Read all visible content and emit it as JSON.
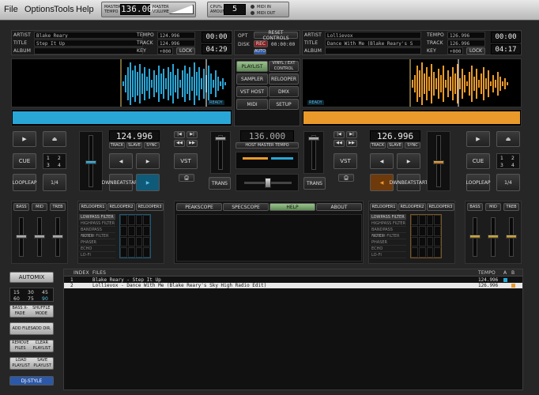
{
  "menubar": {
    "items": [
      "File",
      "Options",
      "Tools",
      "Help"
    ],
    "master_tempo_label": "MASTER TEMPO",
    "master_tempo": "136.000",
    "master_volume_label": "MASTER VOLUME",
    "cpu_label": "CPU% AMOUNT",
    "cpu_value": "5",
    "midi_in": "MIDI IN",
    "midi_out": "MIDI OUT"
  },
  "deck_left": {
    "artist_label": "ARTIST",
    "artist": "Blake Reary",
    "title_label": "TITLE",
    "title": "Step It Up",
    "album_label": "ALBUM",
    "album": "",
    "tempo_label": "TEMPO",
    "tempo": "124.996",
    "track_label": "TRACK",
    "track": "124.996",
    "key_label": "KEY",
    "key": "+000",
    "lock": "LOCK",
    "time1": "00:00",
    "time2": "04:29",
    "bpm_big": "124.996",
    "ready": "READY"
  },
  "deck_right": {
    "artist_label": "ARTIST",
    "artist": "Lollievox",
    "title_label": "TITLE",
    "title": "Dance With Me (Blake Reary's S",
    "album_label": "ALBUM",
    "album": "",
    "tempo_label": "TEMPO",
    "tempo": "126.996",
    "track_label": "TRACK",
    "track": "126.996",
    "key_label": "KEY",
    "key": "+000",
    "lock": "LOCK",
    "time1": "00:00",
    "time2": "04:17",
    "bpm_big": "126.996",
    "ready": "READY"
  },
  "center": {
    "opt": "OPT",
    "disk": "DISK",
    "reset_controls": "RESET CONTROLS",
    "rec": "REC",
    "rec_time": "00:00:00",
    "auto": "AUTO",
    "playlist": "PLAYLIST",
    "vinyl": "VINYL / EXT CONTROL",
    "sampler": "SAMPLER",
    "relooper": "RELOOPER",
    "vst_host": "VST HOST",
    "dmx": "DMX",
    "midi": "MIDI",
    "setup": "SETUP",
    "host_tempo": "136.000",
    "host_tempo_label": "HOST MASTER TEMPO"
  },
  "transport": {
    "play": "▶",
    "eject": "⏏",
    "cue": "CUE",
    "loop": "LOOP",
    "leap": "LEAP",
    "one": "1",
    "two": "2",
    "three": "3",
    "four": "4",
    "frac": "1/4",
    "track_btn": "TRACK",
    "slave_btn": "SLAVE",
    "sync_btn": "SYNC",
    "downbeat": "DWNBEAT",
    "start": "START",
    "vst": "VST",
    "trans": "TRANS",
    "fwd": "▶▶",
    "rew": "◀◀",
    "next": "▶|",
    "prev": "|◀",
    "left": "◀",
    "right": "▶"
  },
  "eq": {
    "bass": "BASS",
    "mid": "MID",
    "treb": "TREB"
  },
  "fx": {
    "tabs": [
      "RELOOPER1",
      "RELOOPER2",
      "RELOOPER3"
    ],
    "filters": [
      "LOWPASS FILTER",
      "HIGHPASS FILTER",
      "BANDPASS FILTER",
      "NOTCH FILTER",
      "PHASER",
      "ECHO",
      "LO-FI"
    ]
  },
  "center_tabs": [
    "PEAKSCOPE",
    "SPECSCOPE",
    "HELP",
    "ABOUT"
  ],
  "sidebar": {
    "automix": "AUTOMIX",
    "counts": [
      "15",
      "30",
      "45",
      "60",
      "75",
      "90"
    ],
    "bass_xfade": "BASS X-FADE",
    "shuffle": "SHUFFLE MODE",
    "add_files": "ADD FILES",
    "add_dir": "ADD DIR.",
    "remove_files": "REMOVE FILES",
    "clear_playlist": "CLEAR PLAYLIST",
    "load_playlist": "LOAD PLAYLIST",
    "save_playlist": "SAVE PLAYLIST",
    "djstyle": "DJ-STYLE"
  },
  "playlist": {
    "headers": {
      "index": "INDEX",
      "files": "FILES",
      "tempo": "TEMPO",
      "a": "A",
      "b": "B"
    },
    "rows": [
      {
        "index": "1",
        "file": "Blake Reary - Step It Up",
        "tempo": "124.996"
      },
      {
        "index": "2",
        "file": "Lollievox - Dance With Me (Blake Reary's Sky High Radio Edit)",
        "tempo": "126.996"
      }
    ]
  },
  "colors": {
    "left_wave": "#29a6d6",
    "right_wave": "#e99a2a",
    "accent_green": "#7fa86f"
  }
}
